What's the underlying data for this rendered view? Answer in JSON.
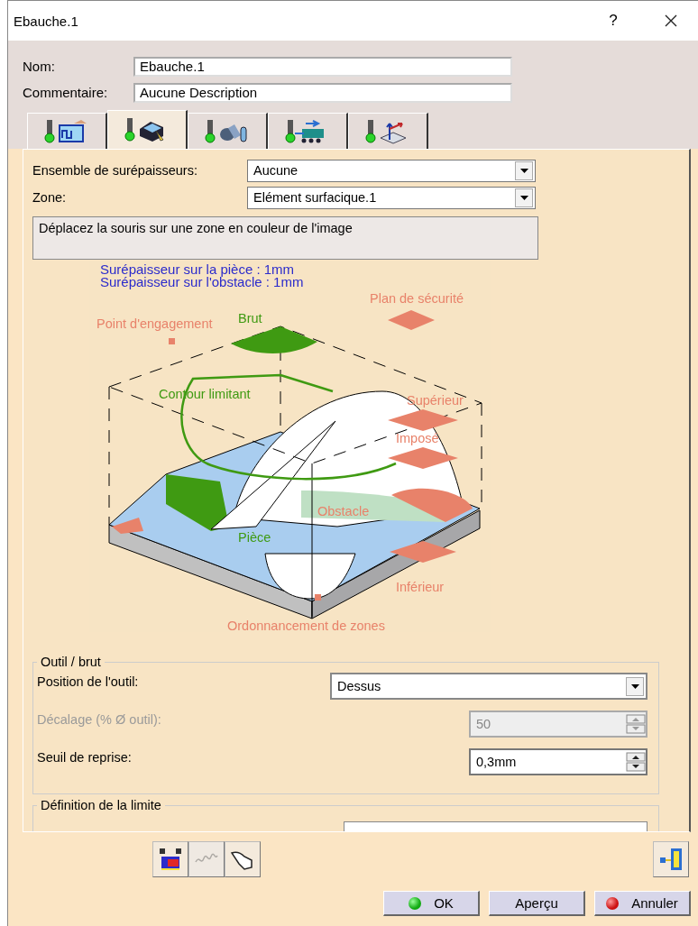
{
  "window": {
    "title": "Ebauche.1",
    "help": "?"
  },
  "name": {
    "label": "Nom:",
    "value": "Ebauche.1"
  },
  "comment": {
    "label": "Commentaire:",
    "value": "Aucune Description"
  },
  "tabs": [
    {
      "kind": "graph",
      "selected": false
    },
    {
      "kind": "part",
      "selected": true
    },
    {
      "kind": "tool",
      "selected": false
    },
    {
      "kind": "machine",
      "selected": false
    },
    {
      "kind": "axis",
      "selected": false
    }
  ],
  "fields": [
    {
      "label": "Ensemble de surépaisseurs:",
      "value": "Aucune"
    },
    {
      "label": "Zone:",
      "value": "Elément surfacique.1"
    }
  ],
  "hint": "Déplacez la souris sur une zone en couleur de l'image",
  "diagram": {
    "thickness_lines": [
      "Surépaisseur sur la pièce : 1mm",
      "Surépaisseur sur l'obstacle : 1mm"
    ],
    "labels": [
      {
        "text": "Plan de sécurité",
        "color": "#e8826a"
      },
      {
        "text": "Point d'engagement",
        "color": "#e8826a"
      },
      {
        "text": "Brut",
        "color": "#3f9a12"
      },
      {
        "text": "Contour limitant",
        "color": "#3f9a12"
      },
      {
        "text": "Supérieur",
        "color": "#e8826a"
      },
      {
        "text": "Imposé",
        "color": "#e8826a"
      },
      {
        "text": "Obstacle",
        "color": "#e8826a"
      },
      {
        "text": "Pièce",
        "color": "#3f9a12"
      },
      {
        "text": "Inférieur",
        "color": "#e8826a"
      },
      {
        "text": "Ordonnancement de zones",
        "color": "#e8826a"
      }
    ]
  },
  "tool_group": {
    "title": "Outil / brut",
    "fields": [
      {
        "label": "Position de l'outil:",
        "kind": "combo",
        "value": "Dessus",
        "disabled": false
      },
      {
        "label": "Décalage (% Ø outil):",
        "kind": "spin",
        "value": "50",
        "disabled": true
      },
      {
        "label": "Seuil de reprise:",
        "kind": "spin",
        "value": "0,3mm",
        "disabled": false
      }
    ]
  },
  "limit_group": {
    "title": "Définition de la limite"
  },
  "toolbar": [
    {
      "disabled": false
    },
    {
      "disabled": true
    },
    {
      "disabled": false
    }
  ],
  "buttons": [
    {
      "label": "OK",
      "kind": "ok"
    },
    {
      "label": "Aperçu",
      "kind": "plain"
    },
    {
      "label": "Annuler",
      "kind": "cancel"
    }
  ]
}
